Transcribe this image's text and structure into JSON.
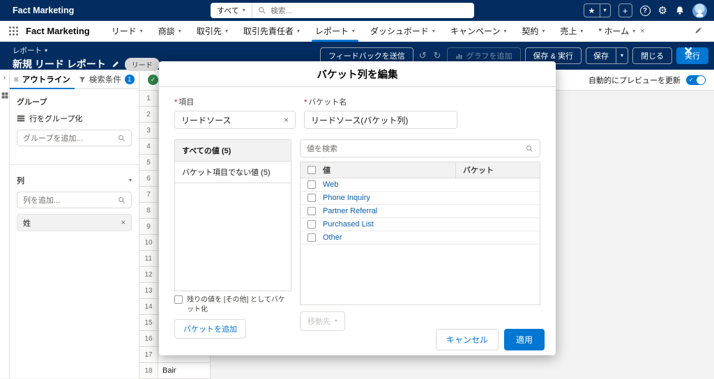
{
  "colors": {
    "header_bg": "#032d60",
    "brand": "#0176d3",
    "link": "#0b5cab",
    "success": "#2e844a"
  },
  "global_header": {
    "org_name": "Fact Marketing",
    "search_scope": "すべて",
    "search_placeholder": "検索..."
  },
  "nav": {
    "app_name": "Fact Marketing",
    "items": [
      "リード",
      "商談",
      "取引先",
      "取引先責任者",
      "レポート",
      "ダッシュボード",
      "キャンペーン",
      "契約",
      "売上"
    ],
    "temp_tab": "* ホーム"
  },
  "report_header": {
    "breadcrumb": "レポート",
    "title": "新規 リード レポート",
    "object_badge": "リード",
    "feedback_button": "フィードバックを送信",
    "undo_icon": "↺",
    "redo_icon": "↻",
    "add_chart_button": "グラフを追加",
    "save_run_button": "保存 & 実行",
    "save_button": "保存",
    "close_button": "閉じる",
    "run_button": "実行"
  },
  "outline_panel": {
    "outline_tab": "アウトライン",
    "filters_tab": "検索条件",
    "filters_count": "1",
    "groups_label": "グループ",
    "group_rows_item": "行をグループ化",
    "add_group_placeholder": "グループを追加...",
    "columns_label": "列",
    "add_column_placeholder": "列を追加...",
    "column_chip": "姓"
  },
  "preview": {
    "auto_update_label": "自動的にプレビューを更新",
    "row_numbers": [
      "1",
      "2",
      "3",
      "4",
      "5",
      "6",
      "7",
      "8",
      "9",
      "10",
      "11",
      "12",
      "13",
      "14",
      "15",
      "16",
      "17",
      "18"
    ],
    "cells": [
      {
        "row": "18",
        "value": "Bair"
      }
    ]
  },
  "modal": {
    "title": "バケット列を編集",
    "field_label": "項目",
    "field_value": "リードソース",
    "bucket_name_label": "バケット名",
    "bucket_name_value": "リードソース(バケット列)",
    "all_values_item": "すべての値 (5)",
    "unbucketed_item": "バケット項目でない値 (5)",
    "remaining_label": "残りの値を [その他] としてバケット化",
    "add_bucket_button": "バケットを追加",
    "search_placeholder": "値を検索",
    "value_col": "値",
    "bucket_col": "バケット",
    "values": [
      "Web",
      "Phone Inquiry",
      "Partner Referral",
      "Purchased List",
      "Other"
    ],
    "move_button": "移動先",
    "cancel_button": "キャンセル",
    "apply_button": "適用"
  }
}
